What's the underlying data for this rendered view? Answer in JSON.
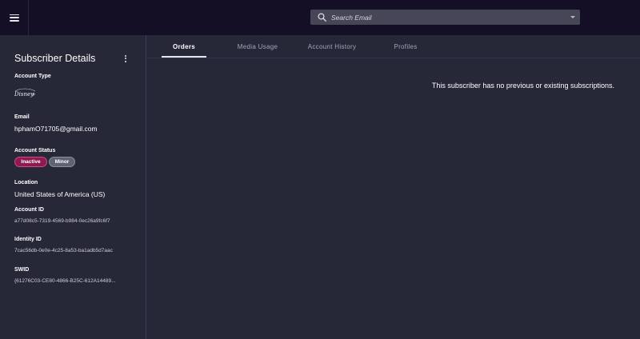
{
  "header": {
    "menu_icon": "hamburger-icon",
    "search": {
      "placeholder": "Search Email",
      "icon": "search-icon",
      "dropdown_icon": "caret-down-icon"
    }
  },
  "sidebar": {
    "title": "Subscriber Details",
    "more_icon": "vertical-dots-icon",
    "account_type": {
      "label": "Account Type",
      "logo": "Disney+"
    },
    "email": {
      "label": "Email",
      "value": "hphamO71705@gmail.com"
    },
    "account_status": {
      "label": "Account Status",
      "badges": [
        "Inactive",
        "Minor"
      ]
    },
    "location": {
      "label": "Location",
      "value": "United States of America (US)"
    },
    "account_id": {
      "label": "Account ID",
      "value": "a77d08c5-7319-4569-b984-0ec26a9fc6f7"
    },
    "identity_id": {
      "label": "Identity ID",
      "value": "7cac56db-0e0e-4c25-8a53-ba1adb5d7aac"
    },
    "swid": {
      "label": "SWID",
      "value": "{61276C03-CE80-4866-B25C-612A14489..."
    }
  },
  "tabs": [
    {
      "label": "Orders",
      "active": true
    },
    {
      "label": "Media Usage",
      "active": false
    },
    {
      "label": "Account History",
      "active": false
    },
    {
      "label": "Profiles",
      "active": false
    }
  ],
  "main": {
    "message": "This subscriber has no previous or existing subscriptions."
  },
  "colors": {
    "topbar_bg": "#140f24",
    "page_bg": "#262737",
    "badge_inactive": "#8e1b50",
    "badge_minor": "#5e6472",
    "search_bg": "#464657"
  }
}
